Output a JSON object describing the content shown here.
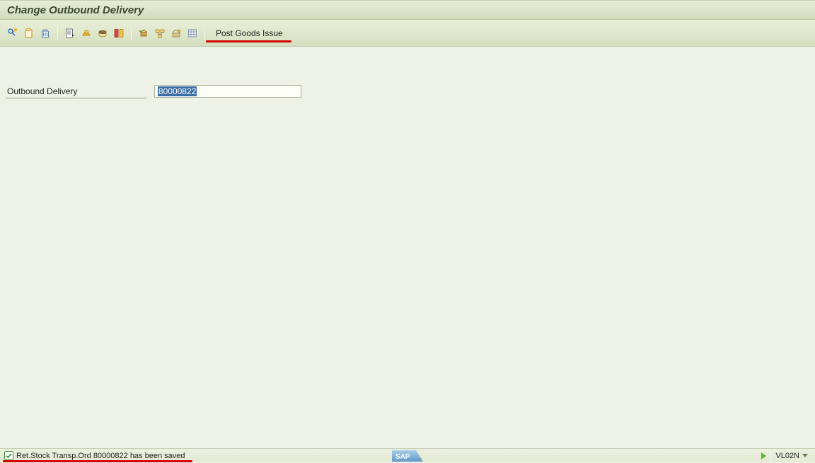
{
  "header": {
    "title": "Change Outbound Delivery"
  },
  "toolbar": {
    "post_goods_issue": "Post Goods Issue",
    "icons": [
      "display-change-icon",
      "other-delivery-icon",
      "delete-icon",
      "header-details-icon",
      "pack-icon",
      "incompleteness-icon",
      "split-icon",
      "post-goods-icon",
      "document-flow-icon",
      "services-icon",
      "overview-icon"
    ]
  },
  "fields": {
    "outbound_delivery_label": "Outbound Delivery",
    "outbound_delivery_value": "80000822"
  },
  "status": {
    "message": "Ret.Stock Transp.Ord 80000822 has been saved",
    "tcode": "VL02N"
  }
}
